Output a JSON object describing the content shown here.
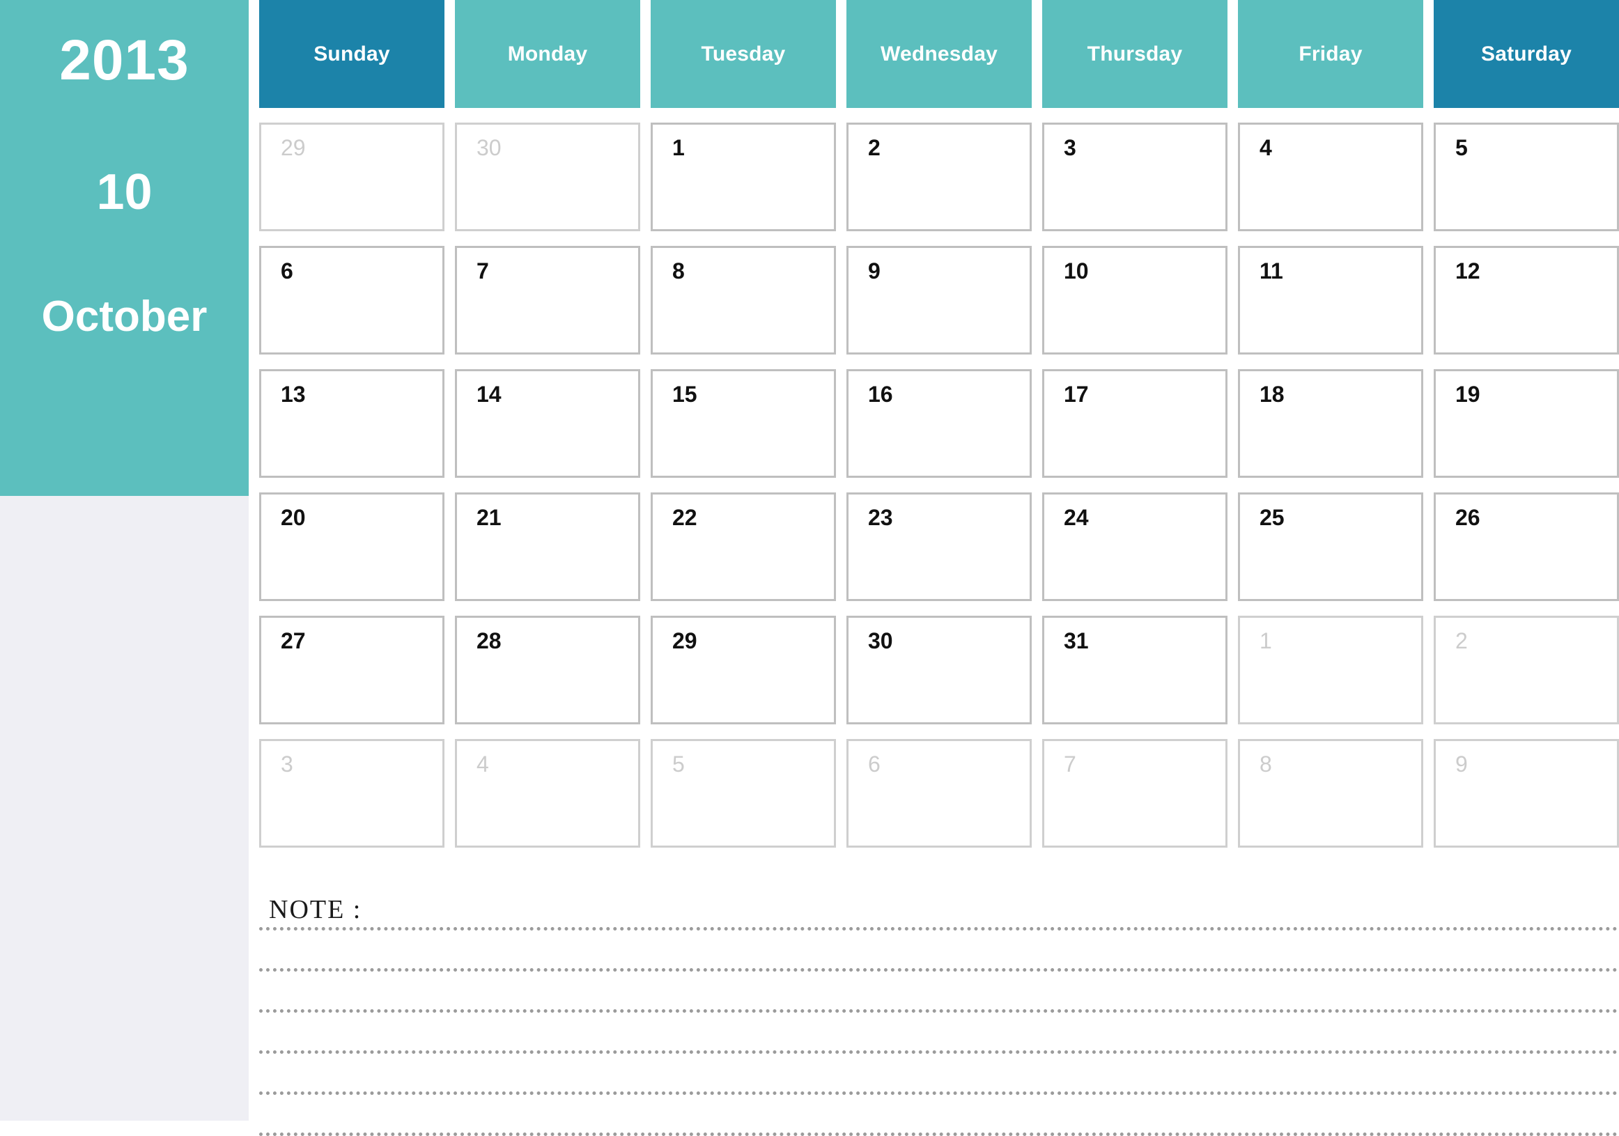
{
  "sidebar": {
    "year": "2013",
    "month_number": "10",
    "month_name": "October",
    "band_color": "#5cbfbe",
    "background_color": "#efeff4"
  },
  "calendar": {
    "weekday_headers": [
      {
        "label": "Sunday",
        "weekend": true
      },
      {
        "label": "Monday",
        "weekend": false
      },
      {
        "label": "Tuesday",
        "weekend": false
      },
      {
        "label": "Wednesday",
        "weekend": false
      },
      {
        "label": "Thursday",
        "weekend": false
      },
      {
        "label": "Friday",
        "weekend": false
      },
      {
        "label": "Saturday",
        "weekend": true
      }
    ],
    "header_color": "#5cbfbe",
    "header_weekend_color": "#1c83a9",
    "weeks": [
      [
        {
          "day": "29",
          "muted": true
        },
        {
          "day": "30",
          "muted": true
        },
        {
          "day": "1",
          "muted": false
        },
        {
          "day": "2",
          "muted": false
        },
        {
          "day": "3",
          "muted": false
        },
        {
          "day": "4",
          "muted": false
        },
        {
          "day": "5",
          "muted": false
        }
      ],
      [
        {
          "day": "6",
          "muted": false
        },
        {
          "day": "7",
          "muted": false
        },
        {
          "day": "8",
          "muted": false
        },
        {
          "day": "9",
          "muted": false
        },
        {
          "day": "10",
          "muted": false
        },
        {
          "day": "11",
          "muted": false
        },
        {
          "day": "12",
          "muted": false
        }
      ],
      [
        {
          "day": "13",
          "muted": false
        },
        {
          "day": "14",
          "muted": false
        },
        {
          "day": "15",
          "muted": false
        },
        {
          "day": "16",
          "muted": false
        },
        {
          "day": "17",
          "muted": false
        },
        {
          "day": "18",
          "muted": false
        },
        {
          "day": "19",
          "muted": false
        }
      ],
      [
        {
          "day": "20",
          "muted": false
        },
        {
          "day": "21",
          "muted": false
        },
        {
          "day": "22",
          "muted": false
        },
        {
          "day": "23",
          "muted": false
        },
        {
          "day": "24",
          "muted": false
        },
        {
          "day": "25",
          "muted": false
        },
        {
          "day": "26",
          "muted": false
        }
      ],
      [
        {
          "day": "27",
          "muted": false
        },
        {
          "day": "28",
          "muted": false
        },
        {
          "day": "29",
          "muted": false
        },
        {
          "day": "30",
          "muted": false
        },
        {
          "day": "31",
          "muted": false
        },
        {
          "day": "1",
          "muted": true
        },
        {
          "day": "2",
          "muted": true
        }
      ],
      [
        {
          "day": "3",
          "muted": true
        },
        {
          "day": "4",
          "muted": true
        },
        {
          "day": "5",
          "muted": true
        },
        {
          "day": "6",
          "muted": true
        },
        {
          "day": "7",
          "muted": true
        },
        {
          "day": "8",
          "muted": true
        },
        {
          "day": "9",
          "muted": true
        }
      ]
    ]
  },
  "note": {
    "label": "NOTE :",
    "line_count": 6
  }
}
